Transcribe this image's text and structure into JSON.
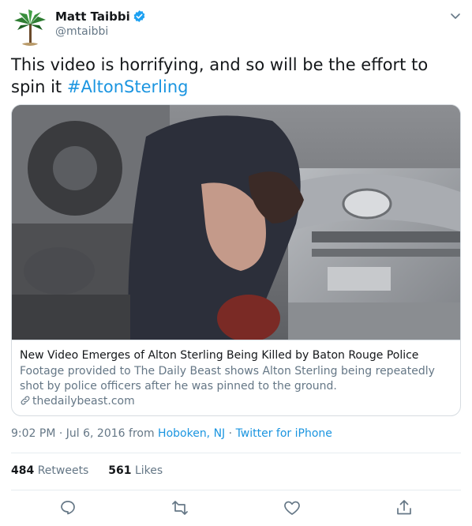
{
  "author": {
    "name": "Matt Taibbi",
    "handle": "@mtaibbi",
    "avatar_icon": "palm-tree-icon",
    "verified_icon": "verified-badge-icon"
  },
  "tweet": {
    "text": "This video is horrifying, and so will be the effort to spin it ",
    "hashtag": "#AltonSterling"
  },
  "card": {
    "title": "New Video Emerges of Alton Sterling Being Killed by Baton Rouge Police",
    "description": "Footage provided to The Daily Beast shows Alton Sterling being repeatedly shot by police officers after he was pinned to the ground.",
    "domain": "thedailybeast.com",
    "link_icon": "link-icon"
  },
  "meta": {
    "time": "9:02 PM",
    "sep1": " · ",
    "date": "Jul 6, 2016",
    "from": " from ",
    "location": "Hoboken, NJ",
    "sep2": " · ",
    "source": "Twitter for iPhone"
  },
  "stats": {
    "retweets_count": "484",
    "retweets_label": "Retweets",
    "likes_count": "561",
    "likes_label": "Likes"
  },
  "actions": {
    "reply_icon": "reply-icon",
    "retweet_icon": "retweet-icon",
    "like_icon": "heart-icon",
    "share_icon": "share-icon"
  },
  "colors": {
    "link": "#1b95e0",
    "secondary": "#657786",
    "primary": "#14171a",
    "border": "#e6ecf0"
  }
}
